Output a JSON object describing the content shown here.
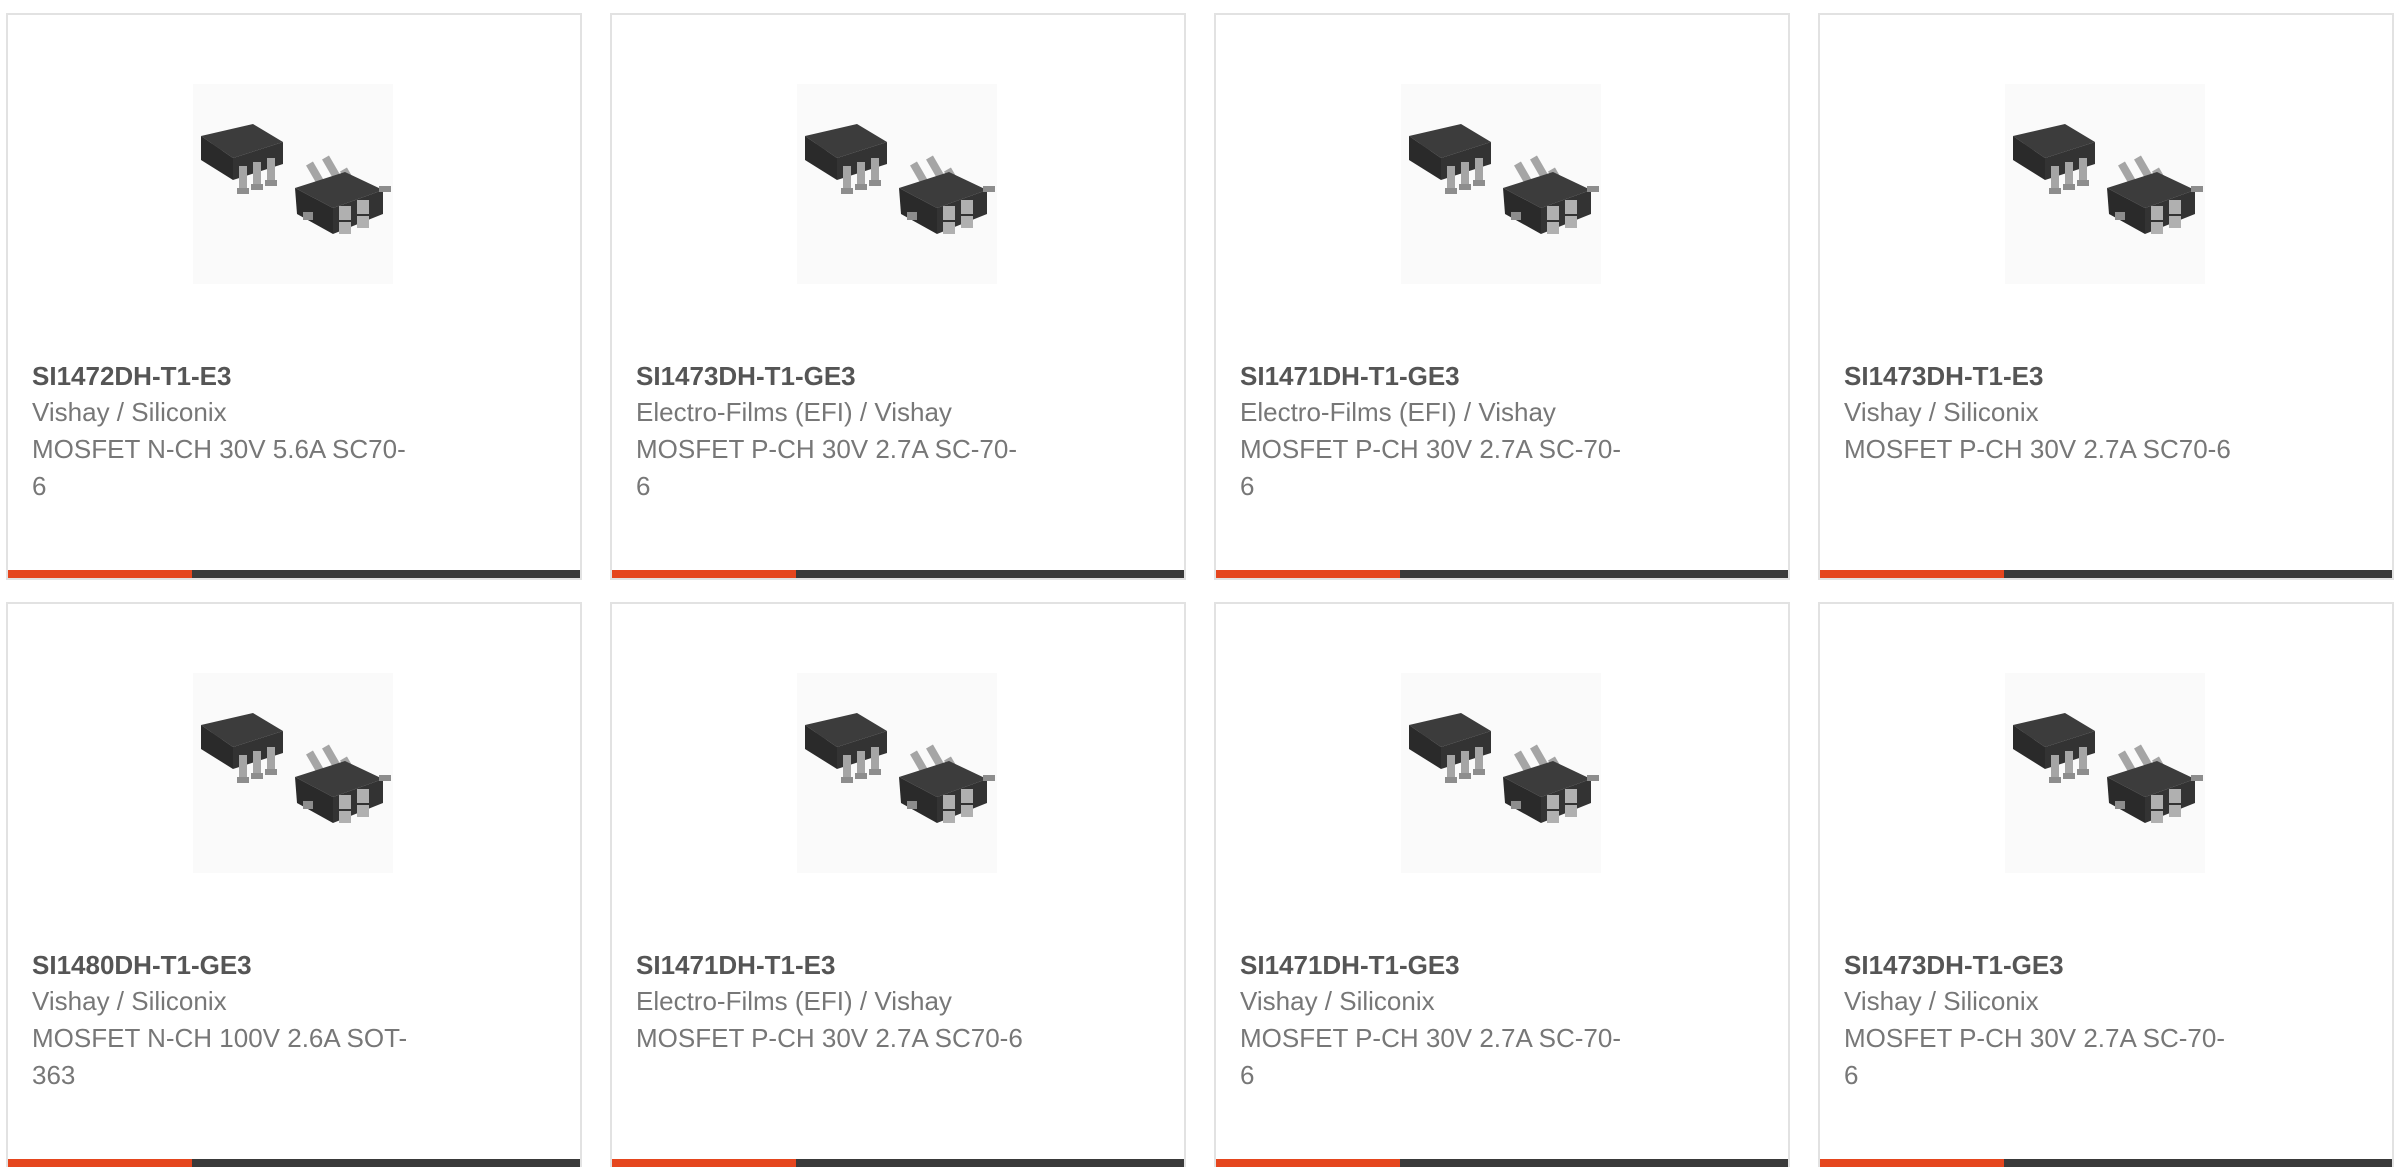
{
  "products": [
    {
      "part": "SI1472DH-T1-E3",
      "manufacturer": "Vishay / Siliconix",
      "desc_line1": "MOSFET N-CH 30V 5.6A SC70-",
      "desc_line2": "6",
      "image_icon": "sc70-6-package-icon"
    },
    {
      "part": "SI1473DH-T1-GE3",
      "manufacturer": "Electro-Films (EFI) / Vishay",
      "desc_line1": "MOSFET P-CH 30V 2.7A SC-70-",
      "desc_line2": "6",
      "image_icon": "sc70-6-package-icon"
    },
    {
      "part": "SI1471DH-T1-GE3",
      "manufacturer": "Electro-Films (EFI) / Vishay",
      "desc_line1": "MOSFET P-CH 30V 2.7A SC-70-",
      "desc_line2": "6",
      "image_icon": "sc70-6-package-icon"
    },
    {
      "part": "SI1473DH-T1-E3",
      "manufacturer": "Vishay / Siliconix",
      "desc_line1": "MOSFET P-CH 30V 2.7A SC70-6",
      "desc_line2": "",
      "image_icon": "sc70-6-package-icon"
    },
    {
      "part": "SI1480DH-T1-GE3",
      "manufacturer": "Vishay / Siliconix",
      "desc_line1": "MOSFET N-CH 100V 2.6A SOT-",
      "desc_line2": "363",
      "image_icon": "sc70-6-package-icon"
    },
    {
      "part": "SI1471DH-T1-E3",
      "manufacturer": "Electro-Films (EFI) / Vishay",
      "desc_line1": "MOSFET P-CH 30V 2.7A SC70-6",
      "desc_line2": "",
      "image_icon": "sc70-6-package-icon"
    },
    {
      "part": "SI1471DH-T1-GE3",
      "manufacturer": "Vishay / Siliconix",
      "desc_line1": "MOSFET P-CH 30V 2.7A SC-70-",
      "desc_line2": "6",
      "image_icon": "sc70-6-package-icon"
    },
    {
      "part": "SI1473DH-T1-GE3",
      "manufacturer": "Vishay / Siliconix",
      "desc_line1": "MOSFET P-CH 30V 2.7A SC-70-",
      "desc_line2": "6",
      "image_icon": "sc70-6-package-icon"
    }
  ],
  "colors": {
    "accent": "#e5461e",
    "bar_dark": "#3a3a3a",
    "part_text": "#555555",
    "meta_text": "#777777",
    "card_border": "#e2e2e2"
  }
}
